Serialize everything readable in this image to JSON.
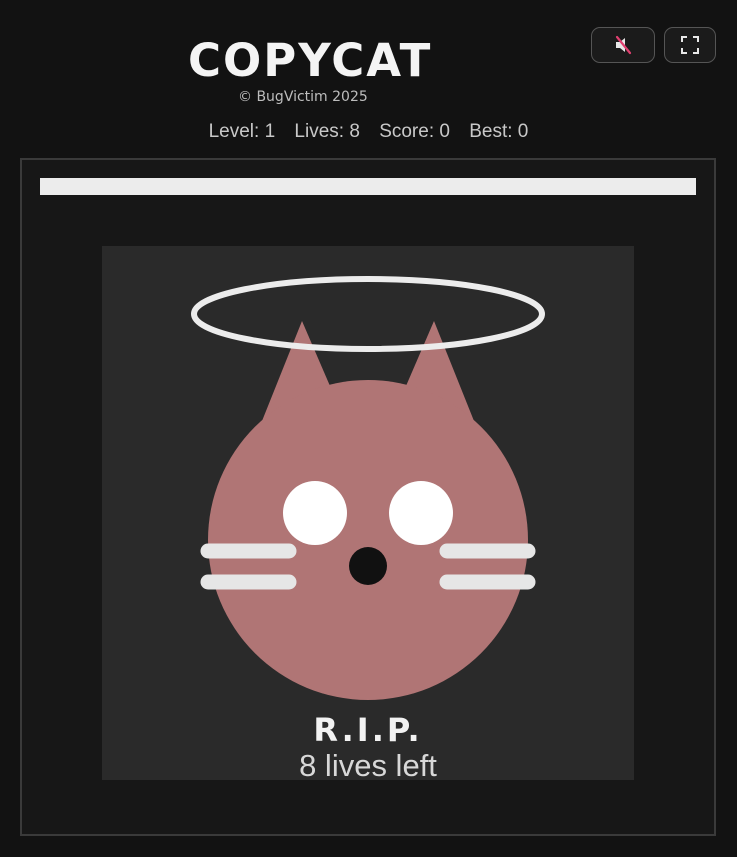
{
  "header": {
    "title": "COPYCAT",
    "copyright": "© BugVictim 2025"
  },
  "stats": {
    "level": "Level: 1",
    "lives": "Lives: 8",
    "score": "Score: 0",
    "best": "Best: 0"
  },
  "controls": {
    "mute_icon": "speaker-muted-icon",
    "fullscreen_icon": "fullscreen-icon"
  },
  "game": {
    "timer_progress": 1.0,
    "status_title": "R.I.P.",
    "status_subtitle": "8 lives left",
    "colors": {
      "cat_body": "#b07575",
      "halo": "#ececec",
      "eyes": "#ffffff",
      "nose": "#111111",
      "whiskers": "#e6e6e6",
      "mute_slash": "#e04070"
    }
  }
}
